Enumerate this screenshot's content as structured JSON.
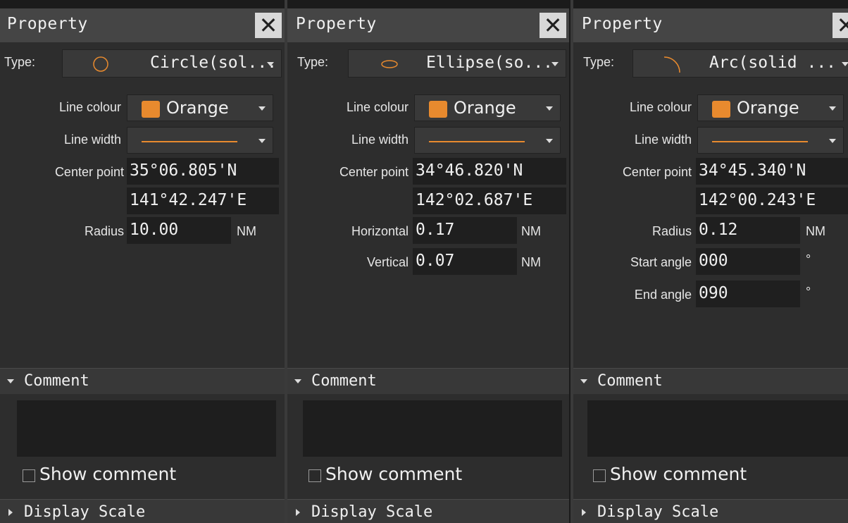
{
  "panels": [
    {
      "title": "Property",
      "type_label": "Type:",
      "type_value": "Circle(sol...",
      "type_icon": "circle-shape-icon",
      "line_colour_label": "Line colour",
      "line_colour_value": "Orange",
      "line_width_label": "Line width",
      "center_label": "Center point",
      "lat": "35°06.805'N",
      "lon": "141°42.247'E",
      "fields": [
        {
          "label": "Radius",
          "value": "10.00",
          "unit": "NM"
        }
      ],
      "comment_label": "Comment",
      "show_comment_label": "Show comment",
      "display_scale_label": "Display Scale"
    },
    {
      "title": "Property",
      "type_label": "Type:",
      "type_value": "Ellipse(so...",
      "type_icon": "ellipse-shape-icon",
      "line_colour_label": "Line colour",
      "line_colour_value": "Orange",
      "line_width_label": "Line width",
      "center_label": "Center point",
      "lat": "34°46.820'N",
      "lon": "142°02.687'E",
      "fields": [
        {
          "label": "Horizontal",
          "value": "0.17",
          "unit": "NM"
        },
        {
          "label": "Vertical",
          "value": "0.07",
          "unit": "NM"
        }
      ],
      "comment_label": "Comment",
      "show_comment_label": "Show comment",
      "display_scale_label": "Display Scale"
    },
    {
      "title": "Property",
      "type_label": "Type:",
      "type_value": "Arc(solid ...",
      "type_icon": "arc-shape-icon",
      "line_colour_label": "Line colour",
      "line_colour_value": "Orange",
      "line_width_label": "Line width",
      "center_label": "Center point",
      "lat": "34°45.340'N",
      "lon": "142°00.243'E",
      "fields": [
        {
          "label": "Radius",
          "value": "0.12",
          "unit": "NM"
        },
        {
          "label": "Start angle",
          "value": "000",
          "unit": "°"
        },
        {
          "label": "End angle",
          "value": "090",
          "unit": "°"
        }
      ],
      "comment_label": "Comment",
      "show_comment_label": "Show comment",
      "display_scale_label": "Display Scale"
    }
  ],
  "colors": {
    "panel_bg": "#2d2d2d",
    "title_bg": "#454545",
    "orange": "#e88a2e",
    "field_bg": "#1f1f1f"
  }
}
